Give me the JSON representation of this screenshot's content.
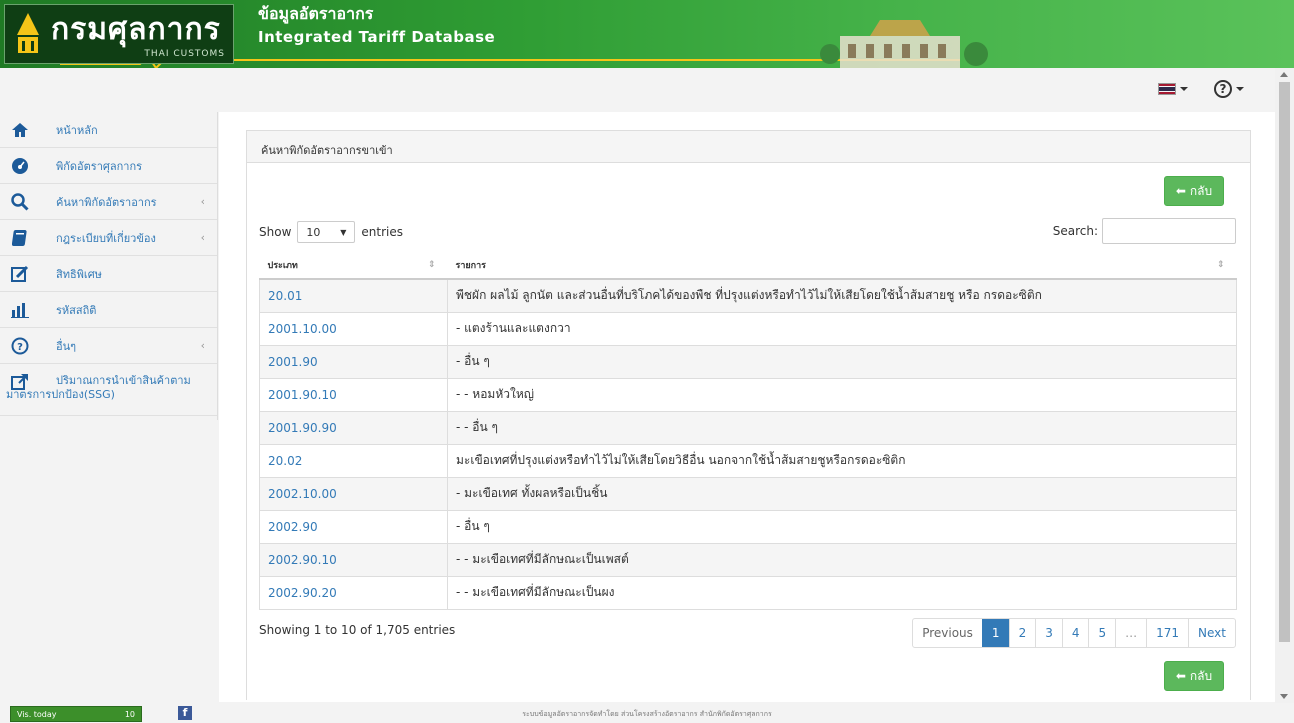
{
  "header": {
    "logo_text": "กรมศุลกากร",
    "logo_sub": "THAI CUSTOMS",
    "title_th": "ข้อมูลอัตราอากร",
    "title_en": "Integrated Tariff Database"
  },
  "toolbar": {
    "language_flag": "thai-flag-icon",
    "help_label": "?"
  },
  "sidebar": {
    "items": [
      {
        "label": "หน้าหลัก",
        "icon": "home-icon"
      },
      {
        "label": "พิกัดอัตราศุลกากร",
        "icon": "dashboard-icon"
      },
      {
        "label": "ค้นหาพิกัดอัตราอากร",
        "icon": "search-icon",
        "chevron": "‹"
      },
      {
        "label": "กฎระเบียบที่เกี่ยวข้อง",
        "icon": "book-icon",
        "chevron": "‹"
      },
      {
        "label": "สิทธิพิเศษ",
        "icon": "edit-icon"
      },
      {
        "label": "รหัสสถิติ",
        "icon": "bar-chart-icon"
      },
      {
        "label": "อื่นๆ",
        "icon": "question-icon",
        "chevron": "‹"
      },
      {
        "label_line1": "ปริมาณการนำเข้าสินค้าตาม",
        "label_line2": "มาตรการปกป้อง(SSG)",
        "icon": "external-link-icon"
      }
    ]
  },
  "panel": {
    "title": "ค้นหาพิกัดอัตราอากรขาเข้า",
    "back_label": "กลับ",
    "show_label": "Show",
    "entries_label": "entries",
    "length_value": "10",
    "search_label": "Search:",
    "search_value": "",
    "columns": [
      "ประเภท",
      "รายการ"
    ],
    "rows": [
      {
        "code": "20.01",
        "desc": "พืชผัก ผลไม้ ลูกนัต และส่วนอื่นที่บริโภคได้ของพืช ที่ปรุงแต่งหรือทำไว้ไม่ให้เสียโดยใช้น้ำส้มสายชู หรือ กรดอะซิติก"
      },
      {
        "code": "2001.10.00",
        "desc": "- แตงร้านและแตงกวา"
      },
      {
        "code": "2001.90",
        "desc": "- อื่น ๆ"
      },
      {
        "code": "2001.90.10",
        "desc": "- - หอมหัวใหญ่"
      },
      {
        "code": "2001.90.90",
        "desc": "- - อื่น ๆ"
      },
      {
        "code": "20.02",
        "desc": "มะเขือเทศที่ปรุงแต่งหรือทำไว้ไม่ให้เสียโดยวิธีอื่น นอกจากใช้น้ำส้มสายชูหรือกรดอะซิติก"
      },
      {
        "code": "2002.10.00",
        "desc": "- มะเขือเทศ ทั้งผลหรือเป็นชิ้น"
      },
      {
        "code": "2002.90",
        "desc": "- อื่น ๆ"
      },
      {
        "code": "2002.90.10",
        "desc": "- - มะเขือเทศที่มีลักษณะเป็นเพสต์"
      },
      {
        "code": "2002.90.20",
        "desc": "- - มะเขือเทศที่มีลักษณะเป็นผง"
      }
    ],
    "info": "Showing 1 to 10 of 1,705 entries",
    "pager": [
      "Previous",
      "1",
      "2",
      "3",
      "4",
      "5",
      "…",
      "171",
      "Next"
    ],
    "active_page": "1"
  },
  "footer": {
    "counter_label": "Vis. today",
    "counter_value": "10",
    "facebook": "f",
    "text": "ระบบข้อมูลอัตราอากรจัดทำโดย ส่วนโครงสร้างอัตราอากร สำนักพิกัดอัตราศุลกากร"
  },
  "colors": {
    "banner_green": "#2f9d34",
    "link_blue": "#337ab7",
    "button_green": "#5cb85c"
  }
}
